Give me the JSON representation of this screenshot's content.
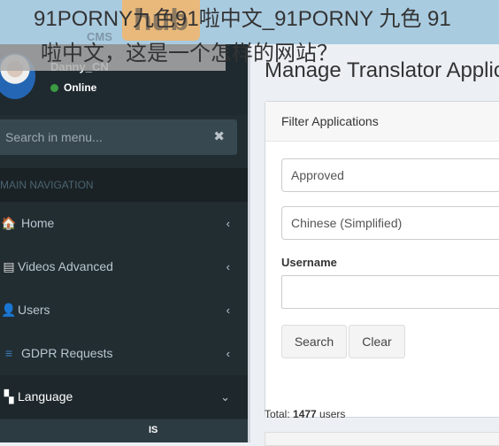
{
  "overlay": {
    "line1": "91PORNY九色91啦中文_91PORNY 九色 91",
    "line2": "啦中文，这是一个怎样的网站？"
  },
  "brand": {
    "logo_text": "hub",
    "sub_text": "CMS"
  },
  "user": {
    "name": "Danny_CN",
    "status": "Online"
  },
  "sidebar": {
    "search_placeholder": "Search in menu...",
    "search_clear": "✖",
    "header": "MAIN NAVIGATION",
    "items": [
      {
        "label": "Home",
        "icon": "home-icon",
        "glyph": "🏠",
        "chevron": "‹"
      },
      {
        "label": "Videos Advanced",
        "icon": "videos-icon",
        "glyph": "▤",
        "chevron": "‹"
      },
      {
        "label": "Users",
        "icon": "user-icon",
        "glyph": "👤",
        "chevron": "‹"
      },
      {
        "label": "GDPR Requests",
        "icon": "database-icon",
        "glyph": "≡",
        "chevron": "‹"
      },
      {
        "label": "Language",
        "icon": "language-icon",
        "glyph": "▚",
        "chevron": "⌄"
      }
    ],
    "sub_text": "IS"
  },
  "main": {
    "title": "Manage Translator Applications",
    "filter": {
      "header": "Filter Applications",
      "status_value": "Approved",
      "language_value": "Chinese (Simplified)",
      "username_label": "Username",
      "username_value": "",
      "search_label": "Search",
      "clear_label": "Clear"
    },
    "total_prefix": "Total: ",
    "total_count": "1477",
    "total_suffix": " users"
  }
}
